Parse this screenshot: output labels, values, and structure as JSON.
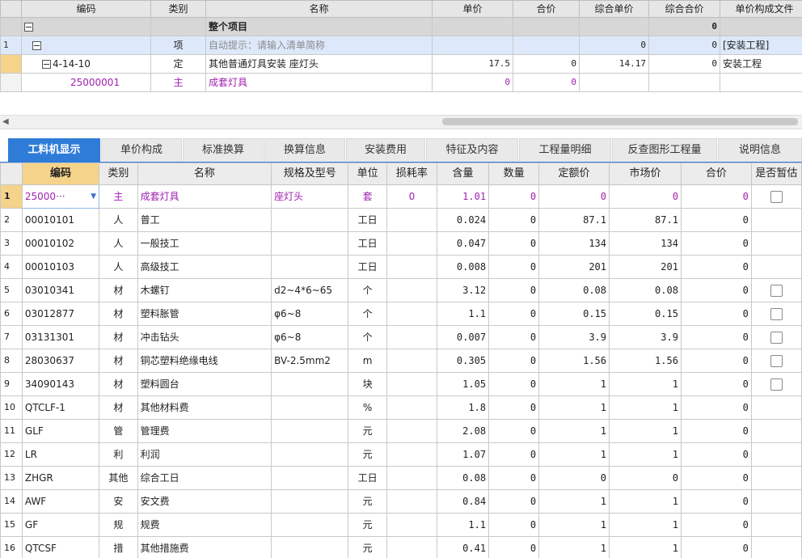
{
  "top_grid": {
    "headers": [
      "编码",
      "类别",
      "名称",
      "单价",
      "合价",
      "综合单价",
      "综合合价",
      "单价构成文件"
    ],
    "group_row": {
      "name": "整个项目",
      "total": "0"
    },
    "rows": [
      {
        "num": "1",
        "code": "",
        "type": "项",
        "name": "自动提示：请输入清单简称",
        "price": "",
        "amount": "",
        "unit_price": "0",
        "total": "0",
        "file": "[安装工程]"
      },
      {
        "num": "",
        "code": "4-14-10",
        "type": "定",
        "name": "其他普通灯具安装 座灯头",
        "price": "17.5",
        "amount": "0",
        "unit_price": "14.17",
        "total": "0",
        "file": "安装工程"
      },
      {
        "num": "",
        "code": "25000001",
        "type": "主",
        "name": "成套灯具",
        "price": "0",
        "amount": "0",
        "unit_price": "",
        "total": "",
        "file": ""
      }
    ]
  },
  "scrollbar": {
    "left_arrow": "◀"
  },
  "tabs": [
    "工料机显示",
    "单价构成",
    "标准换算",
    "换算信息",
    "安装费用",
    "特征及内容",
    "工程量明细",
    "反查图形工程量",
    "说明信息"
  ],
  "active_tab": 0,
  "bottom_grid": {
    "headers": [
      "编码",
      "类别",
      "名称",
      "规格及型号",
      "单位",
      "损耗率",
      "含量",
      "数量",
      "定额价",
      "市场价",
      "合价",
      "是否暂估"
    ],
    "rows": [
      {
        "num": "1",
        "code": "25000···",
        "type": "主",
        "name": "成套灯具",
        "spec": "座灯头",
        "unit": "套",
        "loss": "0",
        "content": "1.01",
        "qty": "0",
        "quota": "0",
        "market": "0",
        "amount": "0",
        "check": true
      },
      {
        "num": "2",
        "code": "00010101",
        "type": "人",
        "name": "普工",
        "spec": "",
        "unit": "工日",
        "loss": "",
        "content": "0.024",
        "qty": "0",
        "quota": "87.1",
        "market": "87.1",
        "amount": "0",
        "check": false
      },
      {
        "num": "3",
        "code": "00010102",
        "type": "人",
        "name": "一般技工",
        "spec": "",
        "unit": "工日",
        "loss": "",
        "content": "0.047",
        "qty": "0",
        "quota": "134",
        "market": "134",
        "amount": "0",
        "check": false
      },
      {
        "num": "4",
        "code": "00010103",
        "type": "人",
        "name": "高级技工",
        "spec": "",
        "unit": "工日",
        "loss": "",
        "content": "0.008",
        "qty": "0",
        "quota": "201",
        "market": "201",
        "amount": "0",
        "check": false
      },
      {
        "num": "5",
        "code": "03010341",
        "type": "材",
        "name": "木螺钉",
        "spec": "d2~4*6~65",
        "unit": "个",
        "loss": "",
        "content": "3.12",
        "qty": "0",
        "quota": "0.08",
        "market": "0.08",
        "amount": "0",
        "check": true
      },
      {
        "num": "6",
        "code": "03012877",
        "type": "材",
        "name": "塑料胀管",
        "spec": "φ6~8",
        "unit": "个",
        "loss": "",
        "content": "1.1",
        "qty": "0",
        "quota": "0.15",
        "market": "0.15",
        "amount": "0",
        "check": true
      },
      {
        "num": "7",
        "code": "03131301",
        "type": "材",
        "name": "冲击钻头",
        "spec": "φ6~8",
        "unit": "个",
        "loss": "",
        "content": "0.007",
        "qty": "0",
        "quota": "3.9",
        "market": "3.9",
        "amount": "0",
        "check": true
      },
      {
        "num": "8",
        "code": "28030637",
        "type": "材",
        "name": "铜芯塑料绝缘电线",
        "spec": "BV-2.5mm2",
        "unit": "m",
        "loss": "",
        "content": "0.305",
        "qty": "0",
        "quota": "1.56",
        "market": "1.56",
        "amount": "0",
        "check": true
      },
      {
        "num": "9",
        "code": "34090143",
        "type": "材",
        "name": "塑料圆台",
        "spec": "",
        "unit": "块",
        "loss": "",
        "content": "1.05",
        "qty": "0",
        "quota": "1",
        "market": "1",
        "amount": "0",
        "check": true
      },
      {
        "num": "10",
        "code": "QTCLF-1",
        "type": "材",
        "name": "其他材料费",
        "spec": "",
        "unit": "%",
        "loss": "",
        "content": "1.8",
        "qty": "0",
        "quota": "1",
        "market": "1",
        "amount": "0",
        "check": false
      },
      {
        "num": "11",
        "code": "GLF",
        "type": "管",
        "name": "管理费",
        "spec": "",
        "unit": "元",
        "loss": "",
        "content": "2.08",
        "qty": "0",
        "quota": "1",
        "market": "1",
        "amount": "0",
        "check": false
      },
      {
        "num": "12",
        "code": "LR",
        "type": "利",
        "name": "利润",
        "spec": "",
        "unit": "元",
        "loss": "",
        "content": "1.07",
        "qty": "0",
        "quota": "1",
        "market": "1",
        "amount": "0",
        "check": false
      },
      {
        "num": "13",
        "code": "ZHGR",
        "type": "其他",
        "name": "综合工日",
        "spec": "",
        "unit": "工日",
        "loss": "",
        "content": "0.08",
        "qty": "0",
        "quota": "0",
        "market": "0",
        "amount": "0",
        "check": false
      },
      {
        "num": "14",
        "code": "AWF",
        "type": "安",
        "name": "安文费",
        "spec": "",
        "unit": "元",
        "loss": "",
        "content": "0.84",
        "qty": "0",
        "quota": "1",
        "market": "1",
        "amount": "0",
        "check": false
      },
      {
        "num": "15",
        "code": "GF",
        "type": "规",
        "name": "规费",
        "spec": "",
        "unit": "元",
        "loss": "",
        "content": "1.1",
        "qty": "0",
        "quota": "1",
        "market": "1",
        "amount": "0",
        "check": false
      },
      {
        "num": "16",
        "code": "QTCSF",
        "type": "措",
        "name": "其他措施费",
        "spec": "",
        "unit": "元",
        "loss": "",
        "content": "0.41",
        "qty": "0",
        "quota": "1",
        "market": "1",
        "amount": "0",
        "check": false
      }
    ]
  },
  "colors": {
    "accent": "#2f7bd8",
    "header_highlight": "#f6d38a",
    "main_material": "#a020b0"
  },
  "icons": {
    "dropdown": "chevron-down-icon",
    "collapse": "tree-collapse-icon",
    "checkbox": "checkbox-icon"
  }
}
